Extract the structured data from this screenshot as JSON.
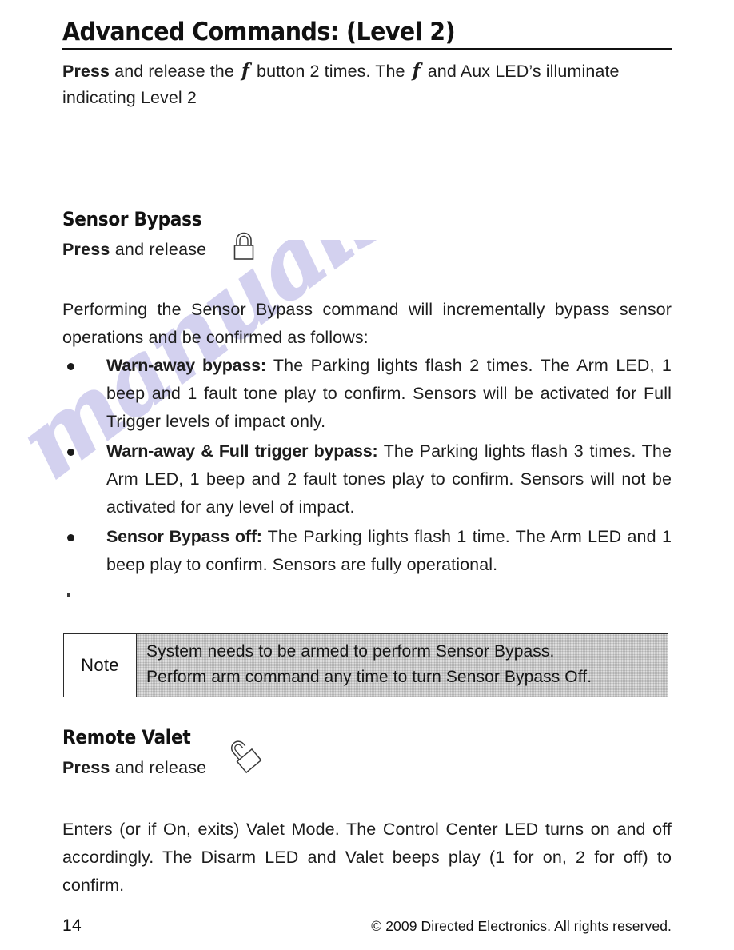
{
  "document": {
    "title": "Advanced Commands: (Level 2)",
    "intro_parts": {
      "press": "Press",
      "before_symbol_1": " and release the ",
      "symbol": "f",
      "after_symbol_1": " button 2 times. The ",
      "after_symbol_2": " and Aux LED’s illuminate indicating Level 2"
    },
    "intro_full": "Press and release the f button 2 times. The f and Aux LED’s illuminate indicating Level 2"
  },
  "sensor_bypass": {
    "heading": "Sensor Bypass",
    "press_bold": "Press",
    "press_rest": " and release",
    "icon": "lock-closed-icon",
    "intro": "Performing the Sensor Bypass command will incrementally bypass sensor operations and be confirmed as follows:",
    "bullets": [
      {
        "lead": "Warn-away bypass:",
        "body": " The Parking lights flash 2 times. The Arm LED, 1 beep and 1 fault tone play to confirm. Sensors will be activated for Full Trigger levels of impact only."
      },
      {
        "lead": "Warn-away & Full trigger bypass:",
        "body": " The Parking lights flash 3 times. The Arm LED, 1 beep and 2 fault tones play to confirm. Sensors will not be activated for any level of impact."
      },
      {
        "lead": "Sensor Bypass off:",
        "body": " The Parking lights flash 1 time. The Arm LED and 1 beep play to confirm. Sensors are fully operational."
      }
    ],
    "stray_mark": "."
  },
  "note_box": {
    "label": "Note",
    "lines": [
      "System needs to be armed to perform Sensor Bypass.",
      "Perform arm command any time to turn Sensor Bypass Off."
    ]
  },
  "remote_valet": {
    "heading": "Remote Valet",
    "press_bold": "Press",
    "press_rest": " and release",
    "icon": "lock-open-icon",
    "body": "Enters (or if On, exits) Valet Mode. The Control Center LED turns on and off accordingly. The Disarm LED and Valet beeps play (1 for on, 2 for off) to confirm."
  },
  "footer": {
    "page_number": "14",
    "copyright": "© 2009 Directed Electronics. All rights reserved."
  },
  "watermark": {
    "text": "manualshive.com"
  },
  "colors": {
    "text": "#1a1a1a",
    "watermark": "#b9b6e6",
    "note_fill": "#dcdcdc",
    "rule": "#111111"
  }
}
